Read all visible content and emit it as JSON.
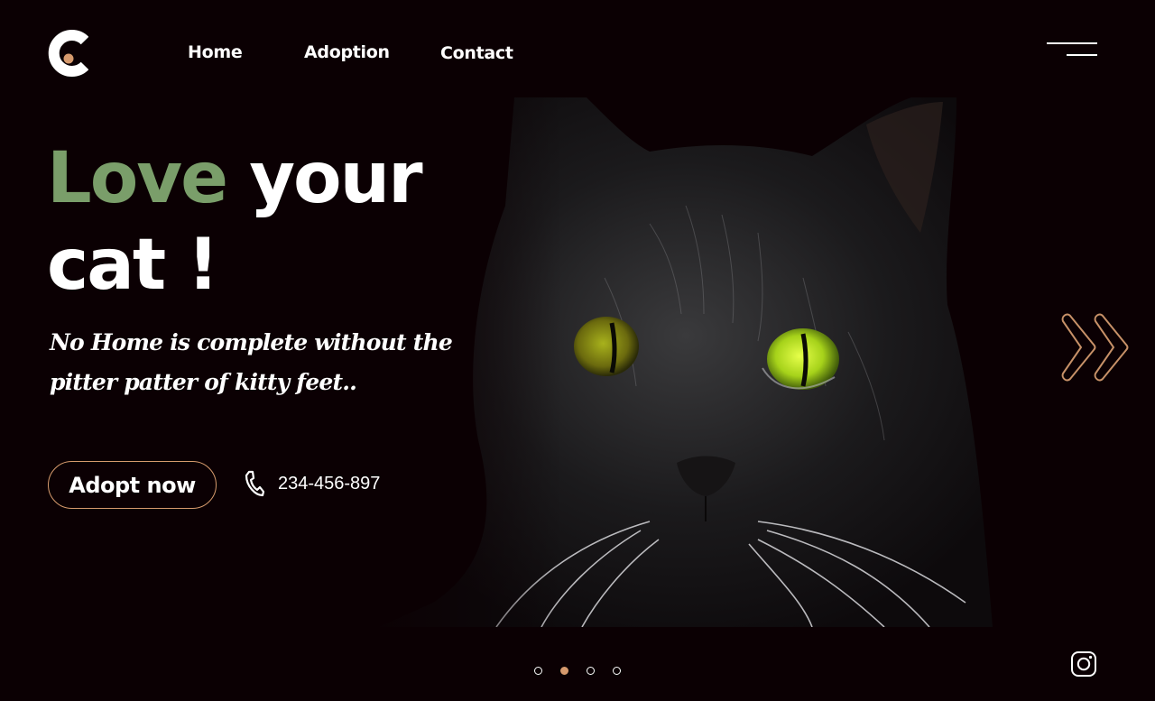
{
  "brand": {
    "logo_icon": "c-logo-icon",
    "accent_color": "#d69a6d"
  },
  "nav": {
    "home": "Home",
    "adoption": "Adoption",
    "contact": "Contact",
    "menu_icon": "hamburger-menu-icon"
  },
  "hero": {
    "headline_accent": "Love",
    "headline_rest_1": "your",
    "headline_rest_2": "cat !",
    "tagline": "No Home is  complete without the pitter patter of kitty feet..",
    "image": "black-cat-photo",
    "accent_green": "#7a9e6a"
  },
  "cta": {
    "adopt_label": "Adopt now",
    "phone_icon": "phone-icon",
    "phone_number": "234-456-897"
  },
  "carousel": {
    "next_icon": "double-chevron-right-icon",
    "slide_count": 4,
    "active_slide": 2
  },
  "social": {
    "instagram_icon": "instagram-icon"
  }
}
